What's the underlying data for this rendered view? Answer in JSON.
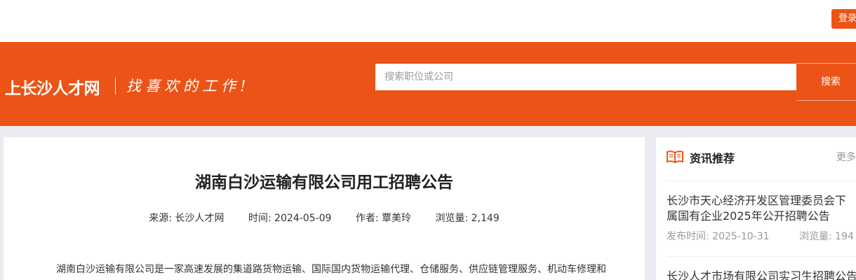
{
  "topbar": {
    "login_label": "登录"
  },
  "header": {
    "logo": "上长沙人才网",
    "slogan": "找喜欢的工作!",
    "search_placeholder": "搜索职位或公司",
    "search_button": "搜索"
  },
  "article": {
    "title": "湖南白沙运输有限公司用工招聘公告",
    "source": "来源: 长沙人才网",
    "time": "时间: 2024-05-09",
    "author": "作者: 覃美玲",
    "views": "浏览量: 2,149",
    "body": "湖南白沙运输有限公司是一家高速发展的集道路货物运输、国际国内货物运输代理、仓储服务、供应链管理服务、机动车修理和"
  },
  "sidebar": {
    "title": "资讯推荐",
    "more": "更多",
    "items": [
      {
        "title": "长沙市天心经济开发区管理委员会下属国有企业2025年公开招聘公告",
        "date": "发布时间: 2025-10-31",
        "views": "浏览量: 194"
      },
      {
        "title": "长沙人才市场有限公司实习生招聘公告"
      }
    ]
  },
  "colors": {
    "brand": "#ec5316",
    "background": "#ecebf1"
  }
}
